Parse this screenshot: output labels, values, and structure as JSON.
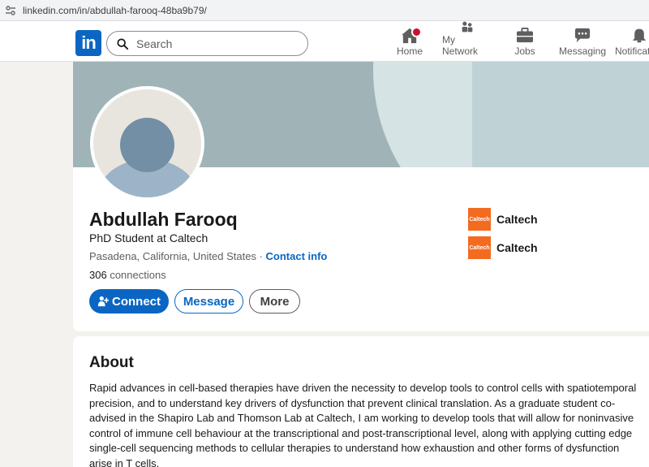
{
  "browser": {
    "url": "linkedin.com/in/abdullah-farooq-48ba9b79/"
  },
  "nav": {
    "logo_text": "in",
    "search_placeholder": "Search",
    "items": [
      {
        "label": "Home",
        "icon": "home-icon",
        "has_badge": true
      },
      {
        "label": "My Network",
        "icon": "network-icon"
      },
      {
        "label": "Jobs",
        "icon": "briefcase-icon"
      },
      {
        "label": "Messaging",
        "icon": "messaging-icon"
      },
      {
        "label": "Notifications",
        "icon": "bell-icon"
      }
    ]
  },
  "profile": {
    "name": "Abdullah Farooq",
    "headline": "PhD Student at Caltech",
    "location": "Pasadena, California, United States",
    "separator": " · ",
    "contact_link": "Contact info",
    "connections_count": "306",
    "connections_label": " connections",
    "buttons": {
      "connect": "Connect",
      "message": "Message",
      "more": "More"
    },
    "education": [
      {
        "logo_text": "Caltech",
        "name": "Caltech"
      },
      {
        "logo_text": "Caltech",
        "name": "Caltech"
      }
    ]
  },
  "about": {
    "title": "About",
    "text": "Rapid advances in cell-based therapies have driven the necessity to develop tools to control cells with spatiotemporal precision, and to understand key drivers of dysfunction that prevent clinical translation. As a graduate student co-advised in the Shapiro Lab and Thomson Lab at Caltech, I am working to develop tools that will allow for noninvasive control of immune cell behaviour at the transcriptional and post-transcriptional level, along with applying cutting edge single-cell sequencing methods to cellular therapies to understand how exhaustion and other forms of dysfunction arise in T cells."
  },
  "colors": {
    "brand": "#0a66c2",
    "badge": "#cb112d",
    "caltech": "#f26b21"
  }
}
